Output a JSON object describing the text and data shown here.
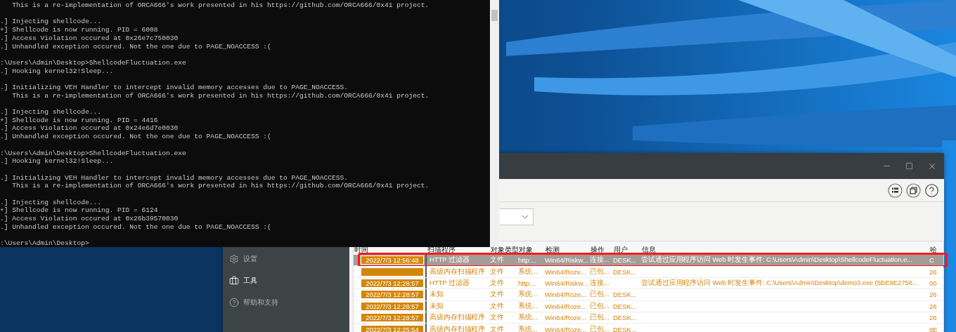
{
  "console": {
    "blocks": [
      [
        "   This is a re-implementation of ORCA666's work presented in his https://github.com/ORCA666/0x41 project."
      ],
      [
        ".] Injecting shellcode...",
        "+] Shellcode is now running. PID = 6008",
        ".] Access Violation occured at 0x26e7c750030",
        ".] Unhandled exception occured. Not the one due to PAGE_NOACCESS :("
      ],
      [
        ":\\Users\\Admin\\Desktop>ShellcodeFluctuation.exe",
        ".] Hooking kernel32!Sleep..."
      ],
      [
        ".] Initializing VEH Handler to intercept invalid memory accesses due to PAGE_NOACCESS.",
        "   This is a re-implementation of ORCA666's work presented in his https://github.com/ORCA666/0x41 project."
      ],
      [
        ".] Injecting shellcode...",
        "+] Shellcode is now running. PID = 4416",
        ".] Access Violation occured at 0x24e6d7e0030",
        ".] Unhandled exception occured. Not the one due to PAGE_NOACCESS :("
      ],
      [
        ":\\Users\\Admin\\Desktop>ShellcodeFluctuation.exe",
        ".] Hooking kernel32!Sleep..."
      ],
      [
        ".] Initializing VEH Handler to intercept invalid memory accesses due to PAGE_NOACCESS.",
        "   This is a re-implementation of ORCA666's work presented in his https://github.com/ORCA666/0x41 project."
      ],
      [
        ".] Injecting shellcode...",
        "+] Shellcode is now running. PID = 6124",
        ".] Access Violation occured at 0x26b39570030",
        ".] Unhandled exception occured. Not the one due to PAGE_NOACCESS :("
      ],
      [
        ":\\Users\\Admin\\Desktop>"
      ]
    ]
  },
  "security_window": {
    "sidebar": {
      "items": [
        {
          "label": "设置",
          "kind": "gear",
          "selected": false
        },
        {
          "label": "工具",
          "kind": "briefcase",
          "selected": true
        },
        {
          "label": "帮助和支持",
          "kind": "help",
          "selected": false
        }
      ]
    },
    "table": {
      "columns": [
        "时间",
        "扫描程序",
        "对象类型",
        "对象",
        "检测",
        "操作",
        "用户",
        "信息",
        "哈"
      ],
      "rows": [
        {
          "selected": true,
          "highlighted": true,
          "cells": [
            "2022/7/3 12:56:48",
            "HTTP 过滤器",
            "文件",
            "http:...",
            "Win64/Riskw...",
            "连接...",
            "DESK...",
            "尝试通过应用程序访问 Web 时发生事件: C:\\Users\\Admin\\Desktop\\ShellcodeFluctuation.e...",
            "C"
          ]
        },
        {
          "selected": false,
          "highlighted": false,
          "cells": [
            null,
            "高级内存扫描程序",
            "文件",
            "系统...",
            "Win64/Roze...",
            "已包...",
            "DESK...",
            null,
            "26"
          ]
        },
        {
          "selected": false,
          "highlighted": false,
          "cells": [
            "2022/7/3 12:28:57",
            "HTTP 过滤器",
            "文件",
            "http:...",
            "Win64/Riskw...",
            "连接...",
            null,
            "尝试通过应用程序访问 Web 时发生事件: C:\\Users\\Admin\\Desktop\\demo3.exe (5BE9E2758...",
            "00"
          ]
        },
        {
          "selected": false,
          "highlighted": false,
          "cells": [
            "2022/7/3 12:28:57",
            "未知",
            "文件",
            "系统...",
            "Win64/Roze...",
            "已包...",
            "DESK...",
            null,
            "26"
          ]
        },
        {
          "selected": false,
          "highlighted": false,
          "cells": [
            "2022/7/3 12:28:57",
            "未知",
            "文件",
            "系统...",
            "Win64/Roze...",
            "已包...",
            "DESK...",
            null,
            "26"
          ]
        },
        {
          "selected": false,
          "highlighted": false,
          "cells": [
            "2022/7/3 12:28:57",
            "高级内存扫描程序",
            "文件",
            "系统...",
            "Win64/Roze...",
            "已包...",
            "DESK...",
            null,
            "26"
          ]
        },
        {
          "selected": false,
          "highlighted": false,
          "cells": [
            "2022/7/3 12:25:54",
            "高级内存扫描程序",
            "文件",
            "系统...",
            "Win64/Roze...",
            "已包...",
            "DESK...",
            null,
            "8E"
          ]
        }
      ]
    }
  }
}
